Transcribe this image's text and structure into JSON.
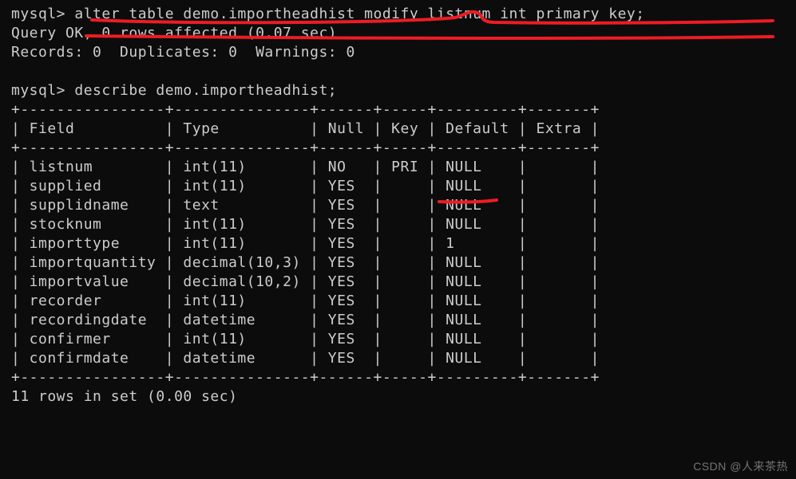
{
  "prompt": "mysql>",
  "cmd1": "alter table demo.importheadhist modify listnum int primary key;",
  "result1_line1": "Query OK, 0 rows affected (0.07 sec)",
  "result1_line2": "Records: 0  Duplicates: 0  Warnings: 0",
  "cmd2": "describe demo.importheadhist;",
  "table_border_top": "+----------------+---------------+------+-----+---------+-------+",
  "table_header_line": "| Field          | Type          | Null | Key | Default | Extra |",
  "table_border_mid": "+----------------+---------------+------+-----+---------+-------+",
  "table_border_bot": "+----------------+---------------+------+-----+---------+-------+",
  "headers": {
    "field": "Field",
    "type": "Type",
    "null": "Null",
    "key": "Key",
    "default": "Default",
    "extra": "Extra"
  },
  "chart_data": {
    "type": "table",
    "title": "describe demo.importheadhist",
    "columns": [
      "Field",
      "Type",
      "Null",
      "Key",
      "Default",
      "Extra"
    ],
    "rows": [
      {
        "Field": "listnum",
        "Type": "int(11)",
        "Null": "NO",
        "Key": "PRI",
        "Default": "NULL",
        "Extra": ""
      },
      {
        "Field": "supplied",
        "Type": "int(11)",
        "Null": "YES",
        "Key": "",
        "Default": "NULL",
        "Extra": ""
      },
      {
        "Field": "supplidname",
        "Type": "text",
        "Null": "YES",
        "Key": "",
        "Default": "NULL",
        "Extra": ""
      },
      {
        "Field": "stocknum",
        "Type": "int(11)",
        "Null": "YES",
        "Key": "",
        "Default": "NULL",
        "Extra": ""
      },
      {
        "Field": "importtype",
        "Type": "int(11)",
        "Null": "YES",
        "Key": "",
        "Default": "1",
        "Extra": ""
      },
      {
        "Field": "importquantity",
        "Type": "decimal(10,3)",
        "Null": "YES",
        "Key": "",
        "Default": "NULL",
        "Extra": ""
      },
      {
        "Field": "importvalue",
        "Type": "decimal(10,2)",
        "Null": "YES",
        "Key": "",
        "Default": "NULL",
        "Extra": ""
      },
      {
        "Field": "recorder",
        "Type": "int(11)",
        "Null": "YES",
        "Key": "",
        "Default": "NULL",
        "Extra": ""
      },
      {
        "Field": "recordingdate",
        "Type": "datetime",
        "Null": "YES",
        "Key": "",
        "Default": "NULL",
        "Extra": ""
      },
      {
        "Field": "confirmer",
        "Type": "int(11)",
        "Null": "YES",
        "Key": "",
        "Default": "NULL",
        "Extra": ""
      },
      {
        "Field": "confirmdate",
        "Type": "datetime",
        "Null": "YES",
        "Key": "",
        "Default": "NULL",
        "Extra": ""
      }
    ]
  },
  "rows_footer": "11 rows in set (0.00 sec)",
  "watermark": "CSDN @人来茶热"
}
